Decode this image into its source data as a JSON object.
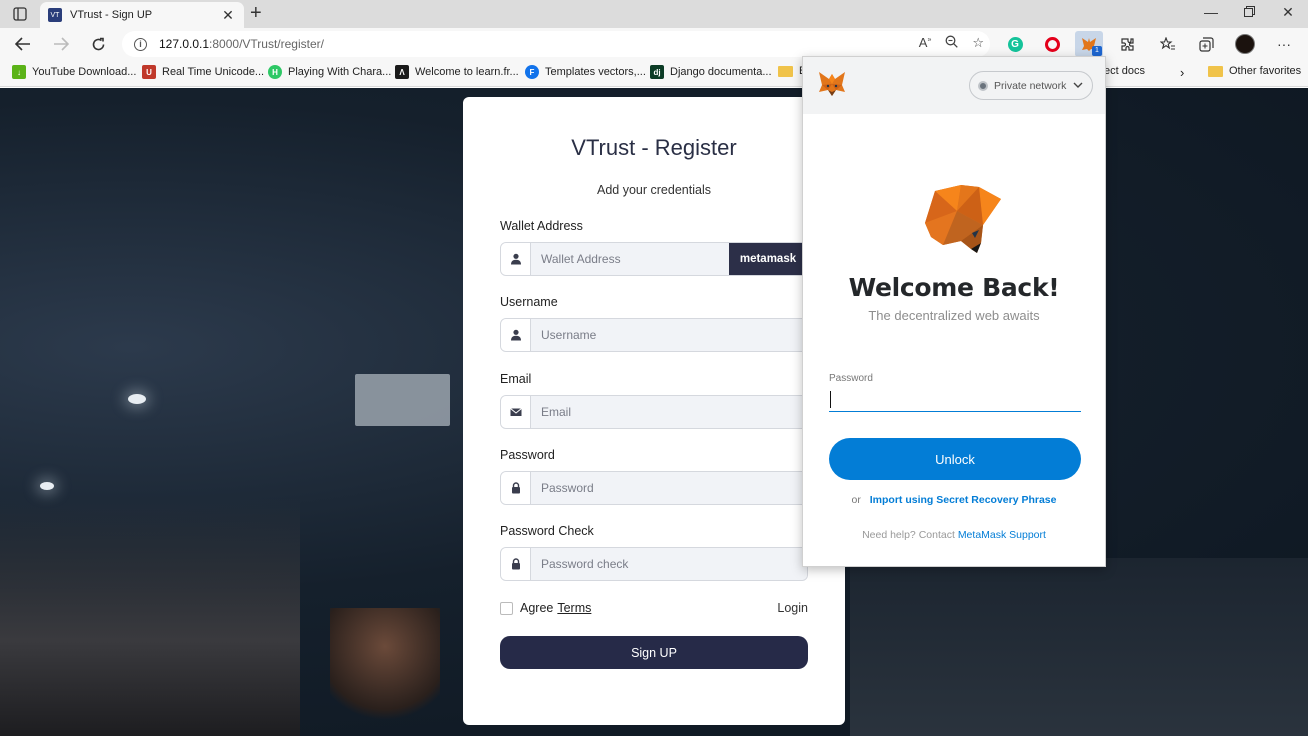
{
  "browser": {
    "tab_title": "VTrust - Sign UP",
    "favicon_text": "VT",
    "url_host": "127.0.0.1",
    "url_rest": ":8000/VTrust/register/",
    "metamask_badge": "1",
    "bookmarks": [
      {
        "label": "YouTube Download...",
        "icon": "download-arrow-icon",
        "color": "#5bb318"
      },
      {
        "label": "Real Time Unicode...",
        "icon": "unicode-icon",
        "color": "#c0392b"
      },
      {
        "label": "Playing With Chara...",
        "icon": "hackerrank-icon",
        "color": "#2ec866"
      },
      {
        "label": "Welcome to learn.fr...",
        "icon": "learn-icon",
        "color": "#1b1b1b"
      },
      {
        "label": "Templates vectors,...",
        "icon": "freepik-icon",
        "color": "#1273eb"
      },
      {
        "label": "Django documenta...",
        "icon": "django-icon",
        "color": "#0c3c26"
      },
      {
        "label": "E",
        "icon": "folder-icon",
        "color": "#f0c34a"
      },
      {
        "label": "ect docs",
        "icon": "",
        "color": ""
      },
      {
        "label": "Other favorites",
        "icon": "folder-icon",
        "color": "#f0c34a"
      }
    ]
  },
  "register": {
    "title": "VTrust - Register",
    "subtitle": "Add your credentials",
    "wallet_label": "Wallet Address",
    "wallet_placeholder": "Wallet Address",
    "metamask_button": "metamask",
    "username_label": "Username",
    "username_placeholder": "Username",
    "email_label": "Email",
    "email_placeholder": "Email",
    "password_label": "Password",
    "password_placeholder": "Password",
    "password_check_label": "Password Check",
    "password_check_placeholder": "Password check",
    "agree_text": "Agree",
    "terms_link": "Terms",
    "login_link": "Login",
    "signup_button": "Sign UP"
  },
  "metamask": {
    "network": "Private network",
    "title": "Welcome Back!",
    "subtitle": "The decentralized web awaits",
    "password_label": "Password",
    "password_value": "",
    "unlock_button": "Unlock",
    "or_text": "or",
    "import_link": "Import using Secret Recovery Phrase",
    "help_text": "Need help? Contact",
    "support_link": "MetaMask Support",
    "brand_color": "#037dd6",
    "fox_color": "#e2761b"
  }
}
